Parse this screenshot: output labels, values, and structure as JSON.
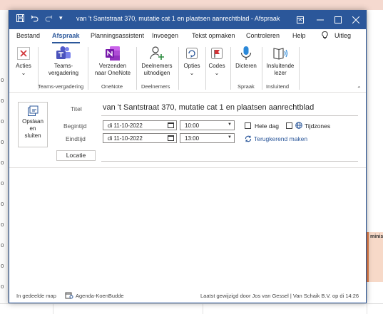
{
  "window": {
    "title": "van 't Santstraat 370, mutatie cat 1 en plaatsen aanrechtblad  -  Afspraak"
  },
  "menu": {
    "tabs": [
      "Bestand",
      "Afspraak",
      "Planningsassistent",
      "Invoegen",
      "Tekst opmaken",
      "Controleren",
      "Help"
    ],
    "active": "Afspraak",
    "tell_me": "Uitleg"
  },
  "ribbon": {
    "acties": "Acties",
    "teams_line1": "Teams-",
    "teams_line2": "vergadering",
    "onenote_line1": "Verzenden",
    "onenote_line2": "naar OneNote",
    "invite_line1": "Deelnemers",
    "invite_line2": "uitnodigen",
    "opties": "Opties",
    "codes": "Codes",
    "dicteren": "Dicteren",
    "reader_line1": "Insluitende",
    "reader_line2": "lezer",
    "groups": {
      "teams": "Teams-vergadering",
      "onenote": "OneNote",
      "deelnemers": "Deelnemers",
      "spraak": "Spraak",
      "insluitend": "Insluitend"
    }
  },
  "form": {
    "send_line1": "Opslaan",
    "send_line2": "en",
    "send_line3": "sluiten",
    "title_label": "Titel",
    "subject": "van 't Santstraat 370, mutatie cat 1 en plaatsen aanrechtblad",
    "start_label": "Begintijd",
    "start_date": "di 11-10-2022",
    "start_time": "10:00",
    "end_label": "Eindtijd",
    "end_date": "di 11-10-2022",
    "end_time": "13:00",
    "all_day": "Hele dag",
    "timezones": "Tijdzones",
    "recurring": "Terugkerend maken",
    "location_button": "Locatie"
  },
  "status": {
    "folder_prefix": "In gedeelde map",
    "folder_name": "Agenda-KoenBudde",
    "modified": "Laatst gewijzigd door Jos van Gessel | Van Schaik B.V. op di 14:26"
  },
  "background": {
    "appt_label": "ministr",
    "ticks": [
      "0",
      "0",
      "0",
      "0",
      "0",
      "0",
      "0",
      "0",
      "0",
      "0",
      "0",
      "0"
    ]
  },
  "colors": {
    "accent": "#2b579a",
    "acties_red": "#d13438",
    "teams": "#5059c9",
    "onenote": "#7719aa",
    "flag": "#d13438"
  }
}
